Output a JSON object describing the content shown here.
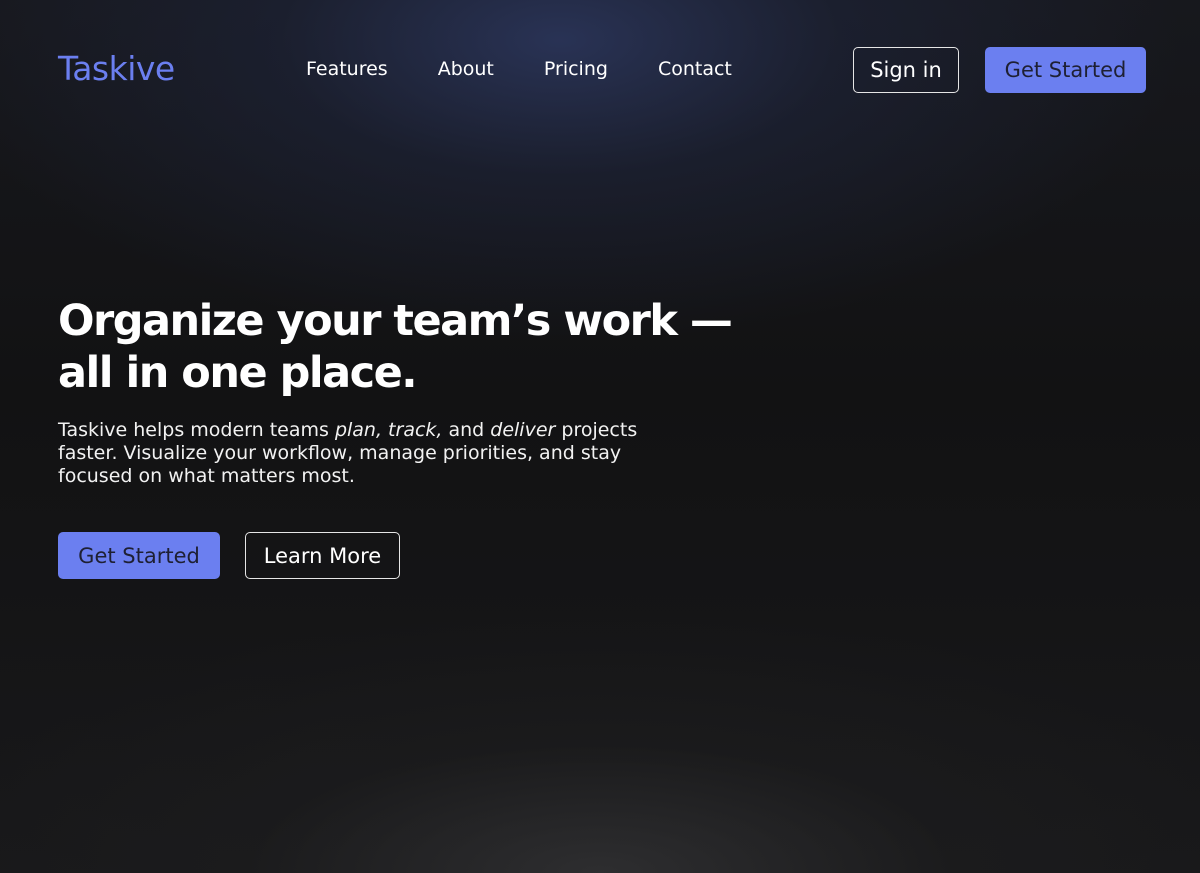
{
  "colors": {
    "accent": "#6b7ff0",
    "background": "#151516",
    "text": "#ffffff",
    "button_text_dark": "#1e2033"
  },
  "nav": {
    "logo": "Taskive",
    "links": [
      {
        "label": "Features"
      },
      {
        "label": "About"
      },
      {
        "label": "Pricing"
      },
      {
        "label": "Contact"
      }
    ],
    "sign_in_label": "Sign in",
    "get_started_label": "Get Started"
  },
  "hero": {
    "title_line1": "Organize your team’s work —",
    "title_line2": "all in one place.",
    "desc_part1": "Taskive helps modern teams ",
    "desc_em1": "plan, track,",
    "desc_part2": " and ",
    "desc_em2": "deliver",
    "desc_part3": " projects faster. Visualize your workflow, manage priorities, and stay focused on what matters most.",
    "primary_cta_label": "Get Started",
    "secondary_cta_label": "Learn More"
  }
}
